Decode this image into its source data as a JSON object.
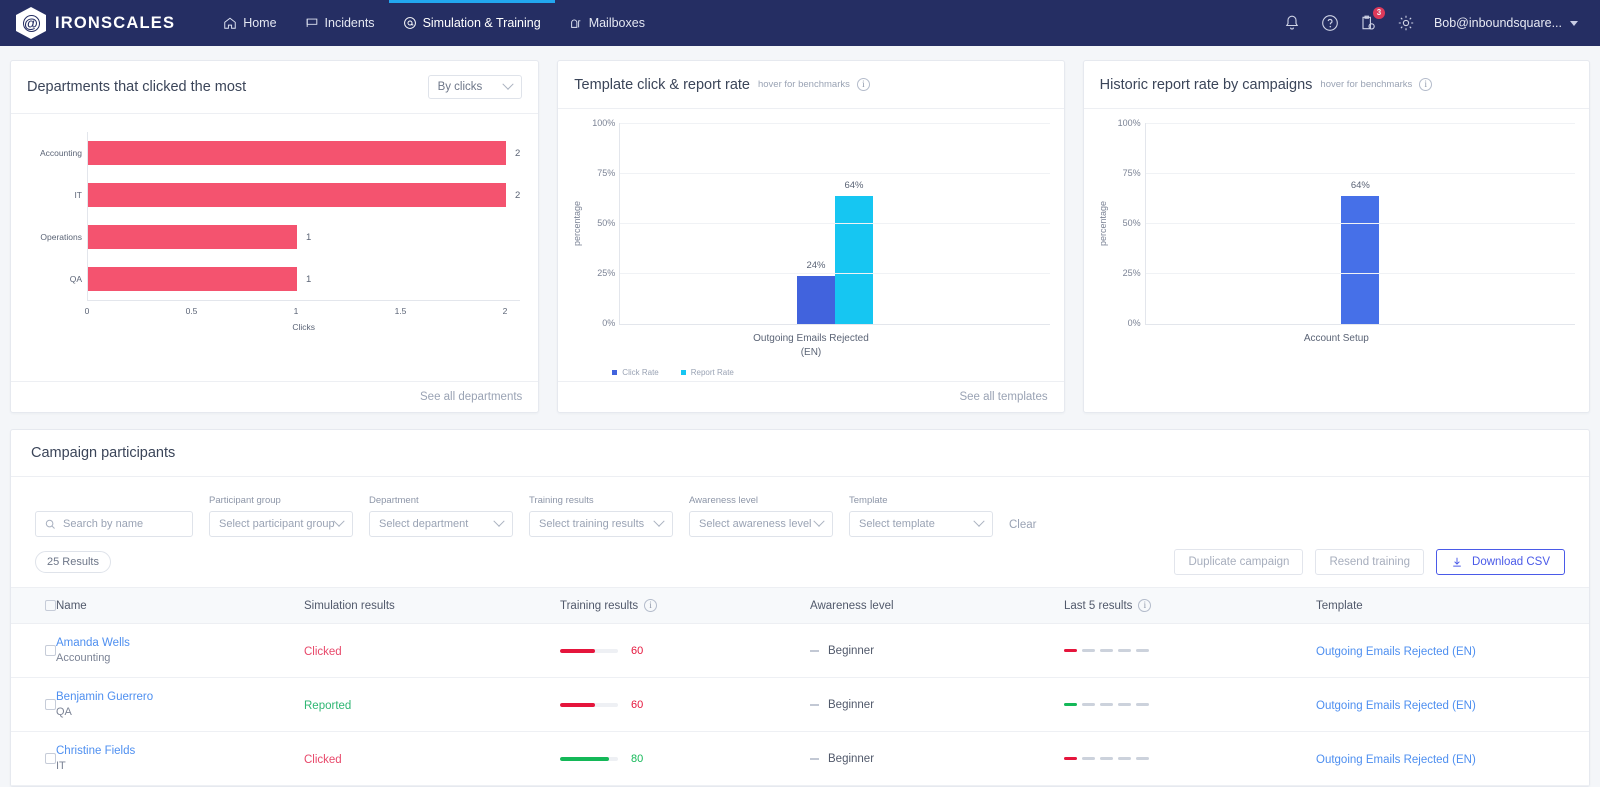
{
  "nav": {
    "brand": "IRONSCALES",
    "brand_glyph": "@",
    "items": [
      {
        "label": "Home",
        "icon": "home-icon",
        "active": false
      },
      {
        "label": "Incidents",
        "icon": "flag-icon",
        "active": false
      },
      {
        "label": "Simulation & Training",
        "icon": "at-circle-icon",
        "active": true
      },
      {
        "label": "Mailboxes",
        "icon": "mailbox-icon",
        "active": false
      }
    ],
    "right": {
      "bell_icon": "bell-icon",
      "help_icon": "help-circle-icon",
      "reports_icon": "clipboard-gear-icon",
      "reports_badge": "3",
      "settings_icon": "gear-icon",
      "user": "Bob@inboundsquare...",
      "caret_icon": "chevron-down-icon"
    }
  },
  "card_departments": {
    "title": "Departments that clicked the most",
    "select_value": "By clicks",
    "footer": "See all departments"
  },
  "card_template": {
    "title": "Template click & report rate",
    "subtitle": "hover for benchmarks",
    "footer": "See all templates"
  },
  "card_historic": {
    "title": "Historic report rate by campaigns",
    "subtitle": "hover for benchmarks"
  },
  "chart_data": [
    {
      "type": "bar",
      "orientation": "horizontal",
      "title": "Departments that clicked the most",
      "categories": [
        "Accounting",
        "IT",
        "Operations",
        "QA"
      ],
      "values": [
        2,
        2,
        1,
        1
      ],
      "value_labels": [
        "2",
        "2",
        "1",
        "1"
      ],
      "xlabel": "Clicks",
      "ylabel": "",
      "xlim": [
        0,
        2
      ],
      "xticks": [
        "0",
        "0.5",
        "1",
        "1.5",
        "2"
      ],
      "bar_color": "#f4536f",
      "grid": false
    },
    {
      "type": "bar",
      "orientation": "vertical",
      "title": "Template click & report rate",
      "categories": [
        "Outgoing Emails Rejected (EN)"
      ],
      "category_lines": [
        "Outgoing Emails Rejected",
        "(EN)"
      ],
      "series": [
        {
          "name": "Click Rate",
          "values": [
            24
          ],
          "labels": [
            "24%"
          ],
          "color": "#4163dd"
        },
        {
          "name": "Report Rate",
          "values": [
            64
          ],
          "labels": [
            "64%"
          ],
          "color": "#16c6f2"
        }
      ],
      "ylabel": "percentage",
      "ylim": [
        0,
        100
      ],
      "yticks": [
        "0%",
        "25%",
        "50%",
        "75%",
        "100%"
      ],
      "legend": [
        "Click Rate",
        "Report Rate"
      ],
      "legend_position": "bottom-left",
      "grid": true
    },
    {
      "type": "bar",
      "orientation": "vertical",
      "title": "Historic report rate by campaigns",
      "categories": [
        "Account Setup"
      ],
      "values": [
        64
      ],
      "value_labels": [
        "64%"
      ],
      "ylabel": "percentage",
      "ylim": [
        0,
        100
      ],
      "yticks": [
        "0%",
        "25%",
        "50%",
        "75%",
        "100%"
      ],
      "bar_color": "#4670e8",
      "grid": true
    }
  ],
  "participants": {
    "title": "Campaign participants",
    "search_placeholder": "Search by name",
    "search_value": "",
    "search_icon": "search-icon",
    "filters": [
      {
        "label": "Participant group",
        "value": "Select participant group"
      },
      {
        "label": "Department",
        "value": "Select department"
      },
      {
        "label": "Training results",
        "value": "Select training results"
      },
      {
        "label": "Awareness level",
        "value": "Select awareness level"
      },
      {
        "label": "Template",
        "value": "Select template"
      }
    ],
    "clear_label": "Clear",
    "results_count": "25 Results",
    "buttons": {
      "duplicate": "Duplicate campaign",
      "resend": "Resend training",
      "download": "Download CSV",
      "download_icon": "download-icon"
    },
    "columns": [
      "Name",
      "Simulation results",
      "Training results",
      "Awareness level",
      "Last 5 results",
      "Template"
    ],
    "rows": [
      {
        "name": "Amanda Wells",
        "department": "Accounting",
        "simulation": "Clicked",
        "simulation_state": "clicked",
        "training_score": "60",
        "training_color": "#e5153c",
        "training_pct": 60,
        "awareness": "Beginner",
        "last5": [
          "#e5153c",
          "#ccd2dc",
          "#ccd2dc",
          "#ccd2dc",
          "#ccd2dc"
        ],
        "template": "Outgoing Emails Rejected (EN)"
      },
      {
        "name": "Benjamin Guerrero",
        "department": "QA",
        "simulation": "Reported",
        "simulation_state": "reported",
        "training_score": "60",
        "training_color": "#e5153c",
        "training_pct": 60,
        "awareness": "Beginner",
        "last5": [
          "#14b858",
          "#ccd2dc",
          "#ccd2dc",
          "#ccd2dc",
          "#ccd2dc"
        ],
        "template": "Outgoing Emails Rejected (EN)"
      },
      {
        "name": "Christine Fields",
        "department": "IT",
        "simulation": "Clicked",
        "simulation_state": "clicked",
        "training_score": "80",
        "training_color": "#14b858",
        "training_pct": 85,
        "awareness": "Beginner",
        "last5": [
          "#e5153c",
          "#ccd2dc",
          "#ccd2dc",
          "#ccd2dc",
          "#ccd2dc"
        ],
        "template": "Outgoing Emails Rejected (EN)"
      }
    ]
  }
}
